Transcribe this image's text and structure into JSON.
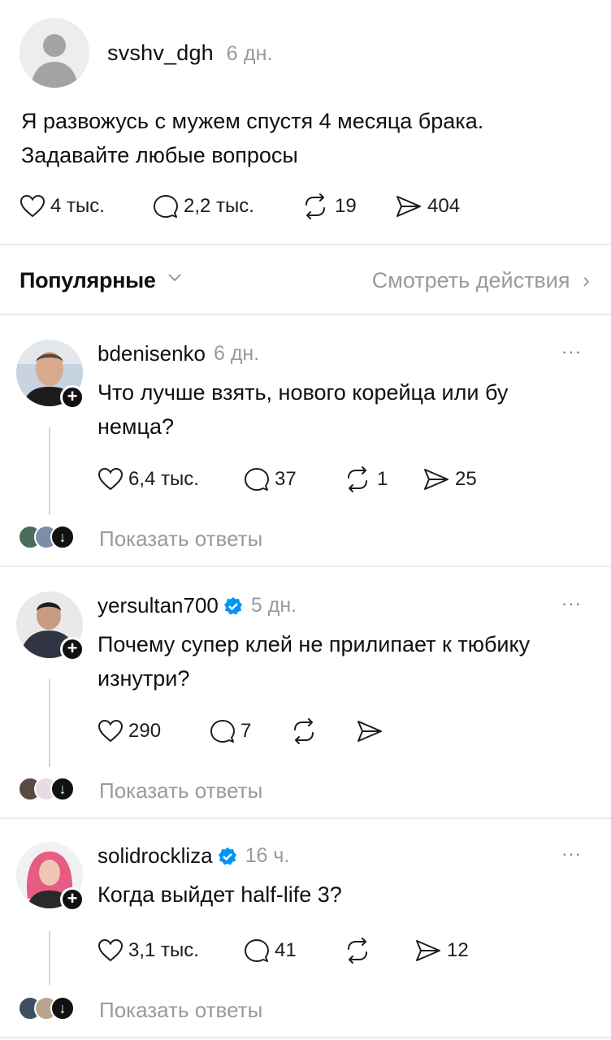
{
  "post": {
    "author": "svshv_dgh",
    "time": "6 дн.",
    "text": "Я развожусь с мужем спустя 4 месяца брака. Задавайте любые вопросы",
    "likes": "4 тыс.",
    "comments": "2,2 тыс.",
    "reposts": "19",
    "shares": "404"
  },
  "sort": {
    "label": "Популярные",
    "activity_link": "Смотреть действия"
  },
  "comments": [
    {
      "author": "bdenisenko",
      "time": "6 дн.",
      "verified": false,
      "text": "Что лучше взять, нового корейца или бу немца?",
      "likes": "6,4 тыс.",
      "comments": "37",
      "reposts": "1",
      "shares": "25",
      "replies_label": "Показать ответы",
      "avatar_color": "#9fb3c8"
    },
    {
      "author": "yersultan700",
      "time": "5 дн.",
      "verified": true,
      "text": "Почему супер клей не прилипает к тюбику изнутри?",
      "likes": "290",
      "comments": "7",
      "reposts": "",
      "shares": "",
      "replies_label": "Показать ответы",
      "avatar_color": "#3a4150"
    },
    {
      "author": "solidrockliza",
      "time": "16 ч.",
      "verified": true,
      "text": "Когда выйдет half-life 3?",
      "likes": "3,1 тыс.",
      "comments": "41",
      "reposts": "",
      "shares": "12",
      "replies_label": "Показать ответы",
      "avatar_color": "#e06a86"
    }
  ],
  "more_glyph": "···",
  "plus_glyph": "+",
  "down_glyph": "↓",
  "colors": {
    "muted": "#9a9a9a",
    "verified": "#0095f6",
    "divider": "#ececec"
  }
}
